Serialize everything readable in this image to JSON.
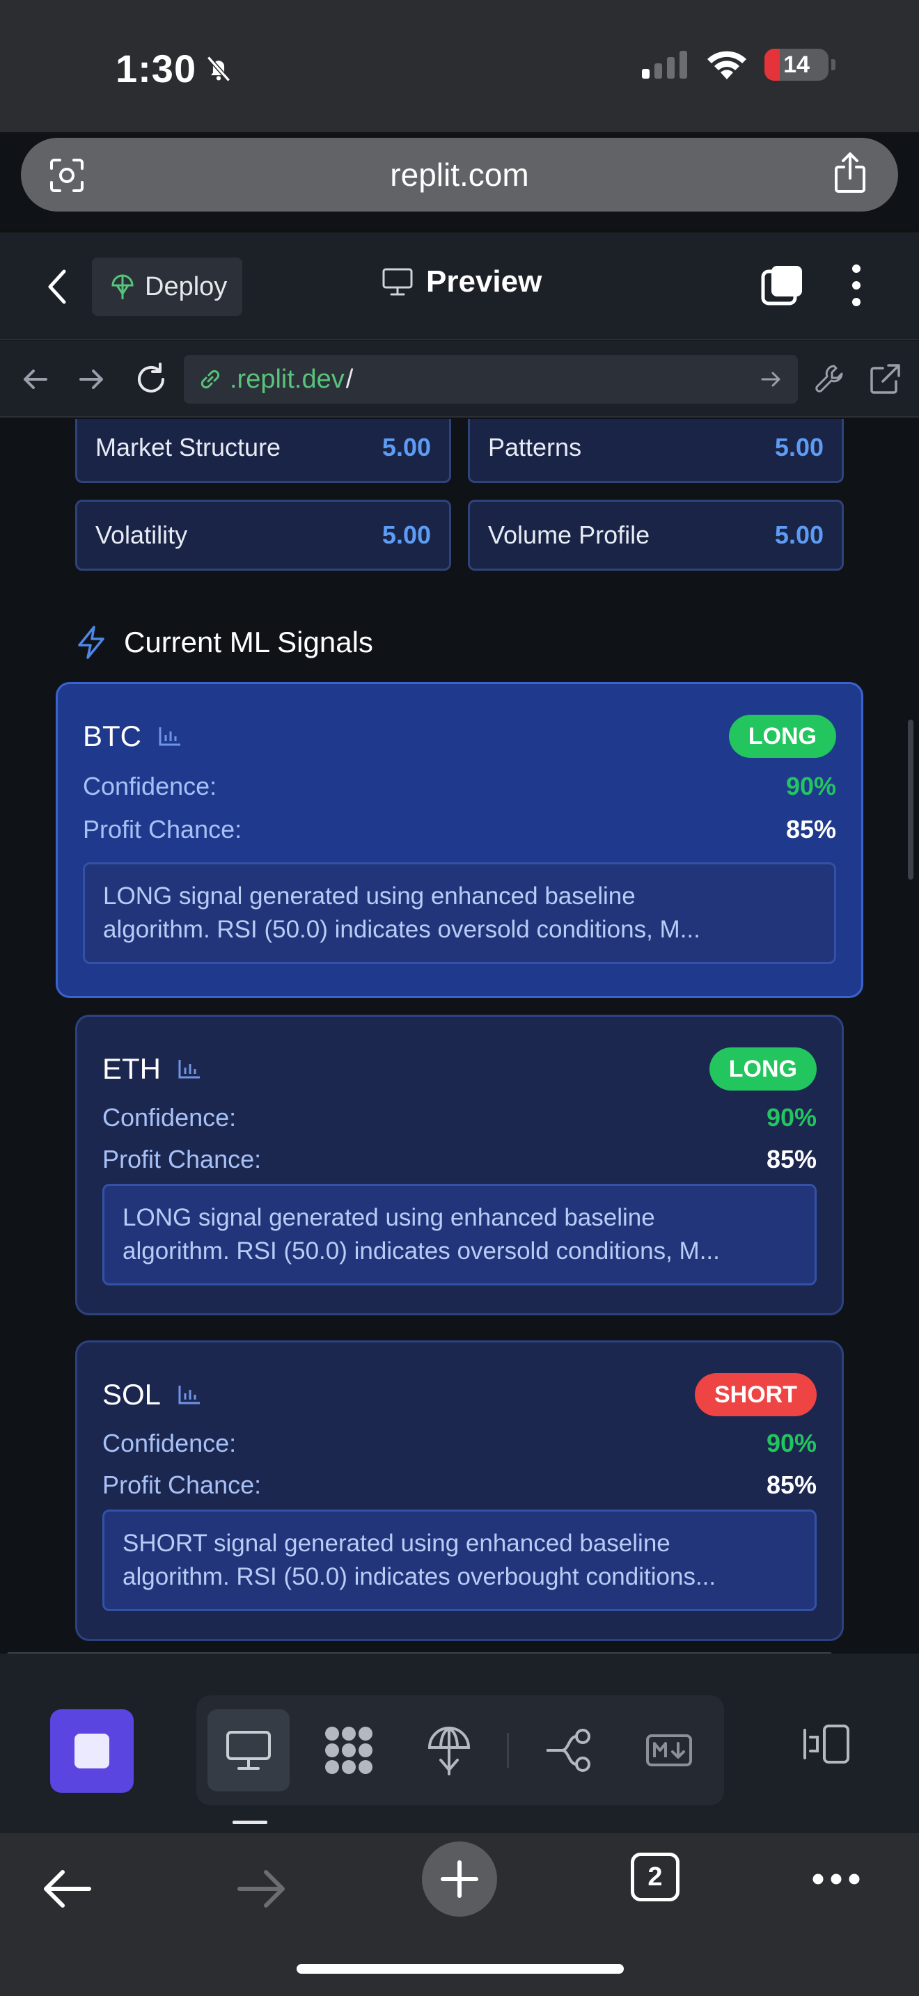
{
  "status_bar": {
    "time": "1:30",
    "battery": "14"
  },
  "safari": {
    "url": "replit.com",
    "tab_count": "2"
  },
  "replit_header": {
    "deploy_label": "Deploy",
    "preview_label": "Preview"
  },
  "webview_nav": {
    "url": ".replit.dev",
    "url_suffix": "/"
  },
  "weights": [
    {
      "label": "Market Structure",
      "value": "5.00"
    },
    {
      "label": "Patterns",
      "value": "5.00"
    },
    {
      "label": "Volatility",
      "value": "5.00"
    },
    {
      "label": "Volume Profile",
      "value": "5.00"
    }
  ],
  "signals_section": {
    "title": "Current ML Signals",
    "icon": "lightning-icon"
  },
  "signals": [
    {
      "symbol": "BTC",
      "direction": "LONG",
      "confidence_label": "Confidence:",
      "confidence": "90%",
      "profit_label": "Profit Chance:",
      "profit": "85%",
      "description_line1": "LONG signal generated using enhanced baseline",
      "description_line2": "algorithm. RSI (50.0) indicates oversold conditions, M..."
    },
    {
      "symbol": "ETH",
      "direction": "LONG",
      "confidence_label": "Confidence:",
      "confidence": "90%",
      "profit_label": "Profit Chance:",
      "profit": "85%",
      "description_line1": "LONG signal generated using enhanced baseline",
      "description_line2": "algorithm. RSI (50.0) indicates oversold conditions, M..."
    },
    {
      "symbol": "SOL",
      "direction": "SHORT",
      "confidence_label": "Confidence:",
      "confidence": "90%",
      "profit_label": "Profit Chance:",
      "profit": "85%",
      "description_line1": "SHORT signal generated using enhanced baseline",
      "description_line2": "algorithm. RSI (50.0) indicates overbought conditions..."
    }
  ],
  "colors": {
    "long": "#22c55e",
    "short": "#ef4444",
    "accent_blue": "#5d9cf5",
    "stop_button": "#5b45e0"
  }
}
